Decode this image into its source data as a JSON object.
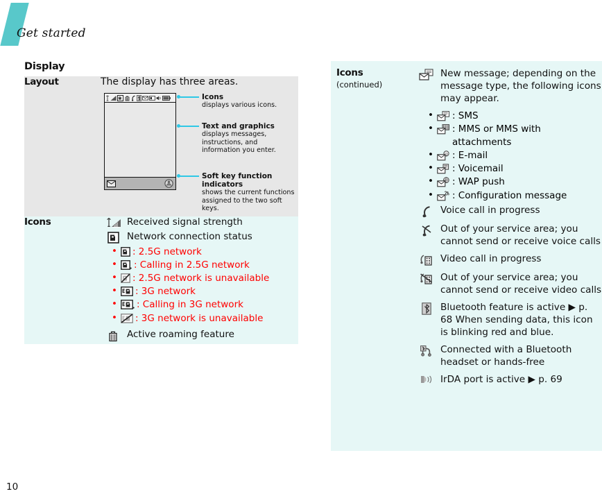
{
  "header": {
    "chapter": "Get started",
    "folio": "10"
  },
  "colors": {
    "teal": "#58c8ca",
    "cyan_row": "#e6f7f6",
    "gray_row": "#e7e7e7",
    "red": "#ff0000"
  },
  "left": {
    "section_title": "Display",
    "layout_row": {
      "label": "Layout",
      "lead": "The display has three areas.",
      "callouts": [
        {
          "title": "Icons",
          "text": "displays various icons."
        },
        {
          "title": "Text and graphics",
          "text": "displays messages, instructions, and information you enter."
        },
        {
          "title": "Soft key function indicators",
          "text": "shows the current functions assigned to the two soft keys."
        }
      ]
    },
    "icons_row": {
      "label": "Icons",
      "items": [
        {
          "icon": "signal-strength-icon",
          "text": "Received signal strength",
          "red": false
        },
        {
          "icon": "network-status-icon",
          "text": "Network connection status",
          "red": false,
          "bullets": [
            {
              "icon": "g-2_5g-icon",
              "text": ": 2.5G network",
              "red": true
            },
            {
              "icon": "g-2_5g-calling-icon",
              "text": ": Calling in 2.5G network",
              "red": true
            },
            {
              "icon": "g-2_5g-unavailable-icon",
              "text": ": 2.5G network is unavailable",
              "red": true
            },
            {
              "icon": "g-3g-icon",
              "text": ": 3G network",
              "red": true
            },
            {
              "icon": "g-3g-calling-icon",
              "text": ": Calling in 3G network",
              "red": true
            },
            {
              "icon": "g-3g-unavailable-icon",
              "text": ": 3G network is unavailable",
              "red": true
            }
          ]
        },
        {
          "icon": "roaming-icon",
          "text": "Active roaming feature",
          "red": false
        }
      ]
    }
  },
  "right": {
    "label_title": "Icons",
    "label_sub": "(continued)",
    "items": [
      {
        "icon": "new-message-icon",
        "text": "New message; depending on the message type, the following icons may appear.",
        "red": false,
        "bullets": [
          {
            "icon": "sms-icon",
            "text": ": SMS",
            "red": false
          },
          {
            "icon": "mms-icon",
            "text": ": MMS or MMS with attachments",
            "red": false
          },
          {
            "icon": "email-icon",
            "text": ": E-mail",
            "red": false
          },
          {
            "icon": "voicemail-icon",
            "text": ": Voicemail",
            "red": false
          },
          {
            "icon": "wap-push-icon",
            "text": ": WAP push",
            "red": false
          },
          {
            "icon": "configuration-message-icon",
            "text": ": Configuration message",
            "red": false
          }
        ]
      },
      {
        "icon": "voice-call-icon",
        "text": "Voice call in progress",
        "red": false
      },
      {
        "icon": "voice-call-out-of-service-icon",
        "text": "Out of your service area; you cannot send or receive voice calls",
        "red": false
      },
      {
        "icon": "video-call-icon",
        "text": "Video call in progress",
        "red": false
      },
      {
        "icon": "video-call-out-of-service-icon",
        "text": "Out of your service area; you cannot send or receive video calls",
        "red": true
      },
      {
        "icon": "bluetooth-icon",
        "text": "Bluetooth feature is active ▶ p. 68 When sending data, this icon is blinking red and blue.",
        "red": false
      },
      {
        "icon": "bluetooth-headset-icon",
        "text": "Connected with a Bluetooth headset or hands-free",
        "red": false
      },
      {
        "icon": "irda-icon",
        "text": "IrDA port is active ▶ p. 69",
        "red": false
      }
    ]
  }
}
